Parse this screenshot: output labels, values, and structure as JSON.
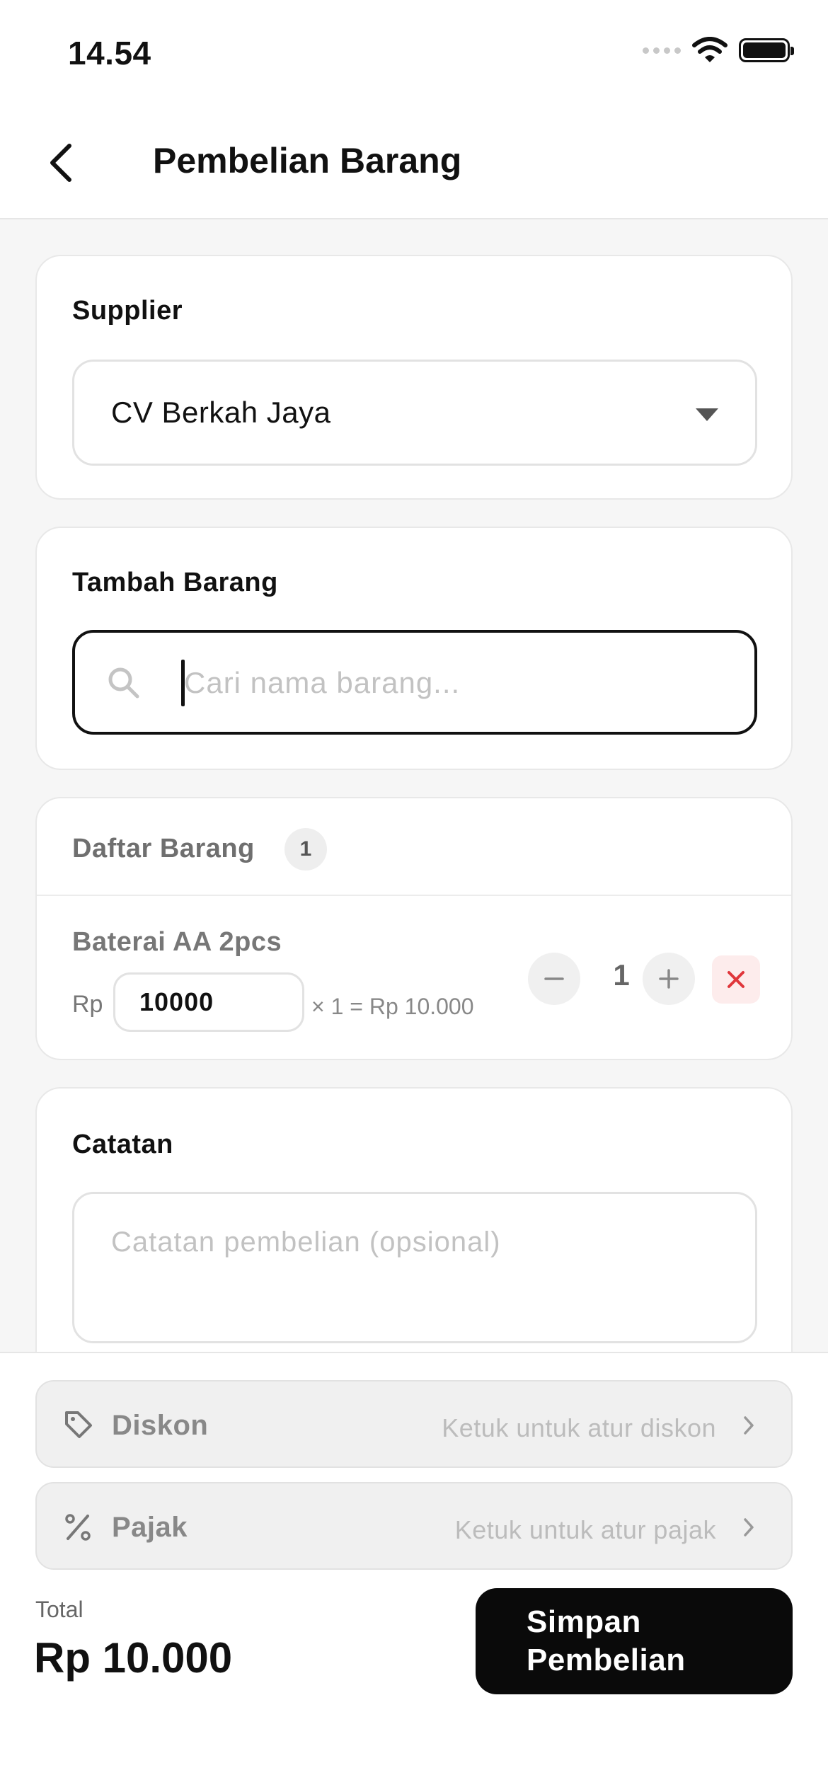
{
  "status_bar": {
    "time": "14.54"
  },
  "header": {
    "title": "Pembelian Barang"
  },
  "supplier": {
    "label": "Supplier",
    "selected": "CV Berkah Jaya"
  },
  "add_item": {
    "label": "Tambah Barang",
    "placeholder": "Cari nama barang..."
  },
  "item_list": {
    "label": "Daftar Barang",
    "count": "1",
    "items": [
      {
        "name": "Baterai AA 2pcs",
        "currency": "Rp",
        "price": "10000",
        "line_total": "× 1 = Rp 10.000",
        "quantity": "1"
      }
    ]
  },
  "notes": {
    "label": "Catatan",
    "placeholder": "Catatan pembelian (opsional)"
  },
  "discount": {
    "label": "Diskon",
    "hint": "Ketuk untuk atur diskon"
  },
  "tax": {
    "label": "Pajak",
    "hint": "Ketuk untuk atur pajak"
  },
  "total": {
    "caption": "Total",
    "value": "Rp 10.000"
  },
  "save_button": {
    "label": "Simpan Pembelian"
  },
  "colors": {
    "primary": "#0a0a0a",
    "danger": "#e0363b",
    "danger_bg": "#fdecec"
  }
}
